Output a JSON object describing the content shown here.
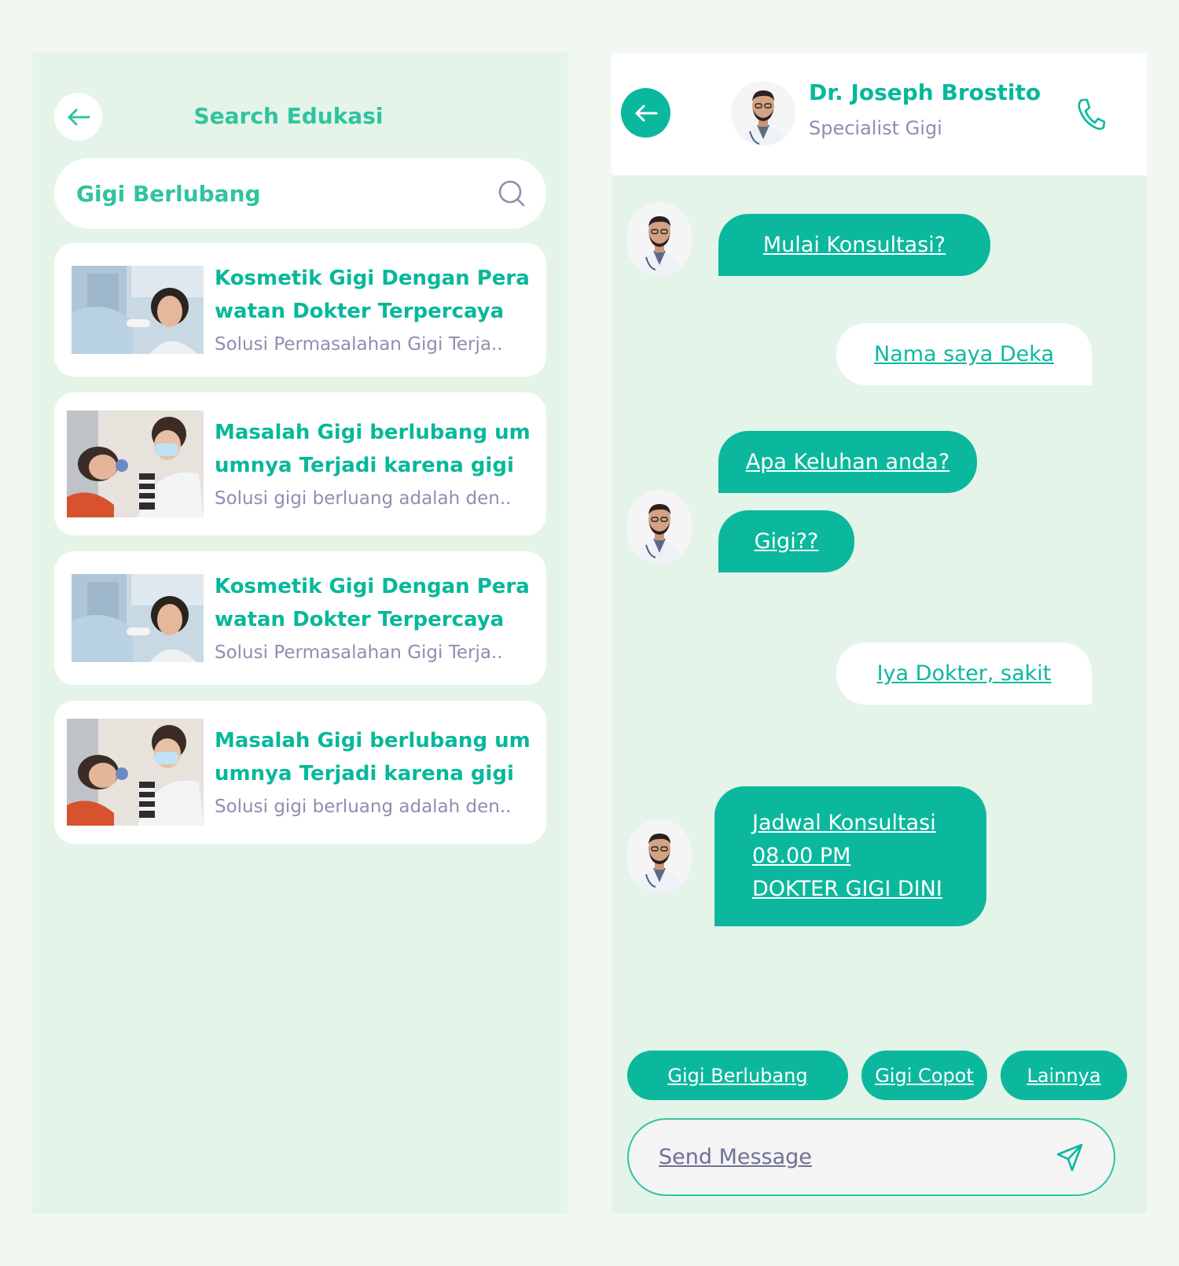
{
  "colors": {
    "accent": "#0bb89e",
    "accent_light": "#2ec4a0",
    "panel_bg": "#e5f4e8",
    "page_bg": "#f1f8f1",
    "muted_text": "#8c8fb0"
  },
  "search_screen": {
    "back_icon": "arrow-left-icon",
    "title": "Search Edukasi",
    "search": {
      "value": "Gigi Berlubang",
      "icon": "search-icon"
    },
    "results": [
      {
        "title": "Kosmetik Gigi Dengan Pera watan Dokter Terpercaya",
        "desc": "Solusi Permasalahan Gigi Terja..",
        "image": "dentist-examining-woman-photo"
      },
      {
        "title": "Masalah Gigi berlubang um umnya Terjadi karena gigi",
        "desc": "Solusi gigi berluang adalah den..",
        "image": "dentist-with-mask-patient-photo"
      },
      {
        "title": "Kosmetik Gigi Dengan Pera watan Dokter Terpercaya",
        "desc": "Solusi Permasalahan Gigi Terja..",
        "image": "dentist-examining-woman-photo"
      },
      {
        "title": "Masalah Gigi berlubang um umnya Terjadi karena gigi",
        "desc": "Solusi gigi berluang adalah den..",
        "image": "dentist-with-mask-patient-photo"
      }
    ]
  },
  "chat_screen": {
    "header": {
      "back_icon": "arrow-left-icon",
      "doctor_name": "Dr. Joseph Brostito",
      "specialty": "Specialist Gigi",
      "call_icon": "phone-icon"
    },
    "messages": [
      {
        "from": "doctor",
        "text": "Mulai Konsultasi?"
      },
      {
        "from": "user",
        "text": "Nama saya Deka"
      },
      {
        "from": "doctor",
        "text": "Apa Keluhan anda?"
      },
      {
        "from": "doctor",
        "text": "Gigi??"
      },
      {
        "from": "user",
        "text": "Iya Dokter, sakit"
      },
      {
        "from": "doctor",
        "lines": [
          "Jadwal Konsultasi",
          "08.00 PM",
          "DOKTER GIGI DINI"
        ]
      }
    ],
    "quick_replies": [
      "Gigi Berlubang",
      "Gigi Copot",
      "Lainnya"
    ],
    "composer": {
      "placeholder": "Send Message",
      "send_icon": "send-icon"
    }
  }
}
